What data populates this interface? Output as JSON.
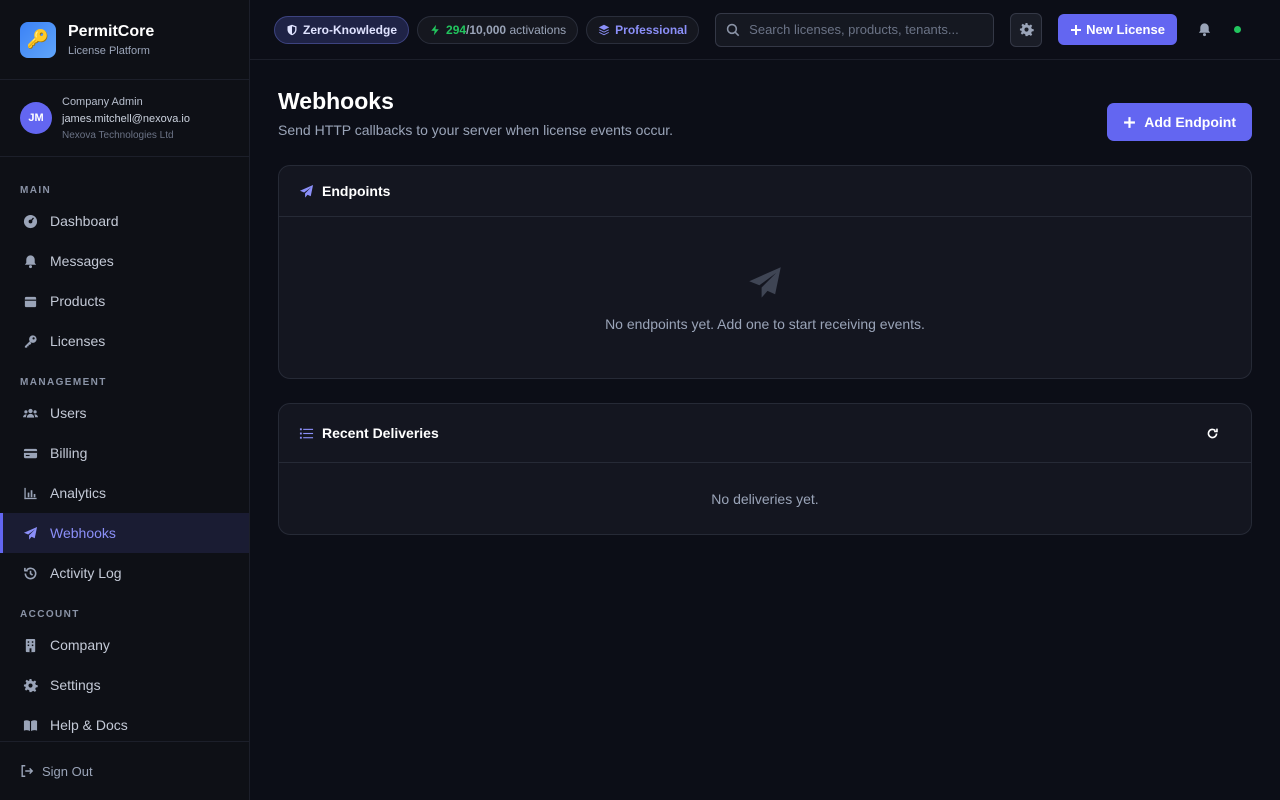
{
  "brand": {
    "name": "PermitCore",
    "subtitle": "License Platform"
  },
  "user": {
    "initials": "JM",
    "role": "Company Admin",
    "email": "james.mitchell@nexova.io",
    "company": "Nexova Technologies Ltd"
  },
  "nav": {
    "sections": {
      "main": "MAIN",
      "management": "MANAGEMENT",
      "account": "ACCOUNT"
    },
    "main_items": [
      "Dashboard",
      "Messages",
      "Products",
      "Licenses"
    ],
    "management_items": [
      "Users",
      "Billing",
      "Analytics",
      "Webhooks",
      "Activity Log"
    ],
    "account_items": [
      "Company",
      "Settings",
      "Help & Docs"
    ],
    "active": "Webhooks",
    "sign_out": "Sign Out"
  },
  "topbar": {
    "zero_knowledge": "Zero-Knowledge",
    "activations_used": "294",
    "activations_total": "/10,000",
    "activations_label": "activations",
    "plan": "Professional",
    "search_placeholder": "Search licenses, products, tenants...",
    "new_license": "New License"
  },
  "page": {
    "title": "Webhooks",
    "subtitle": "Send HTTP callbacks to your server when license events occur.",
    "add_endpoint": "Add Endpoint"
  },
  "endpoints": {
    "title": "Endpoints",
    "empty": "No endpoints yet. Add one to start receiving events."
  },
  "deliveries": {
    "title": "Recent Deliveries",
    "empty": "No deliveries yet."
  },
  "colors": {
    "accent": "#6366f1",
    "success": "#22c55e",
    "background": "#0c0e17"
  }
}
